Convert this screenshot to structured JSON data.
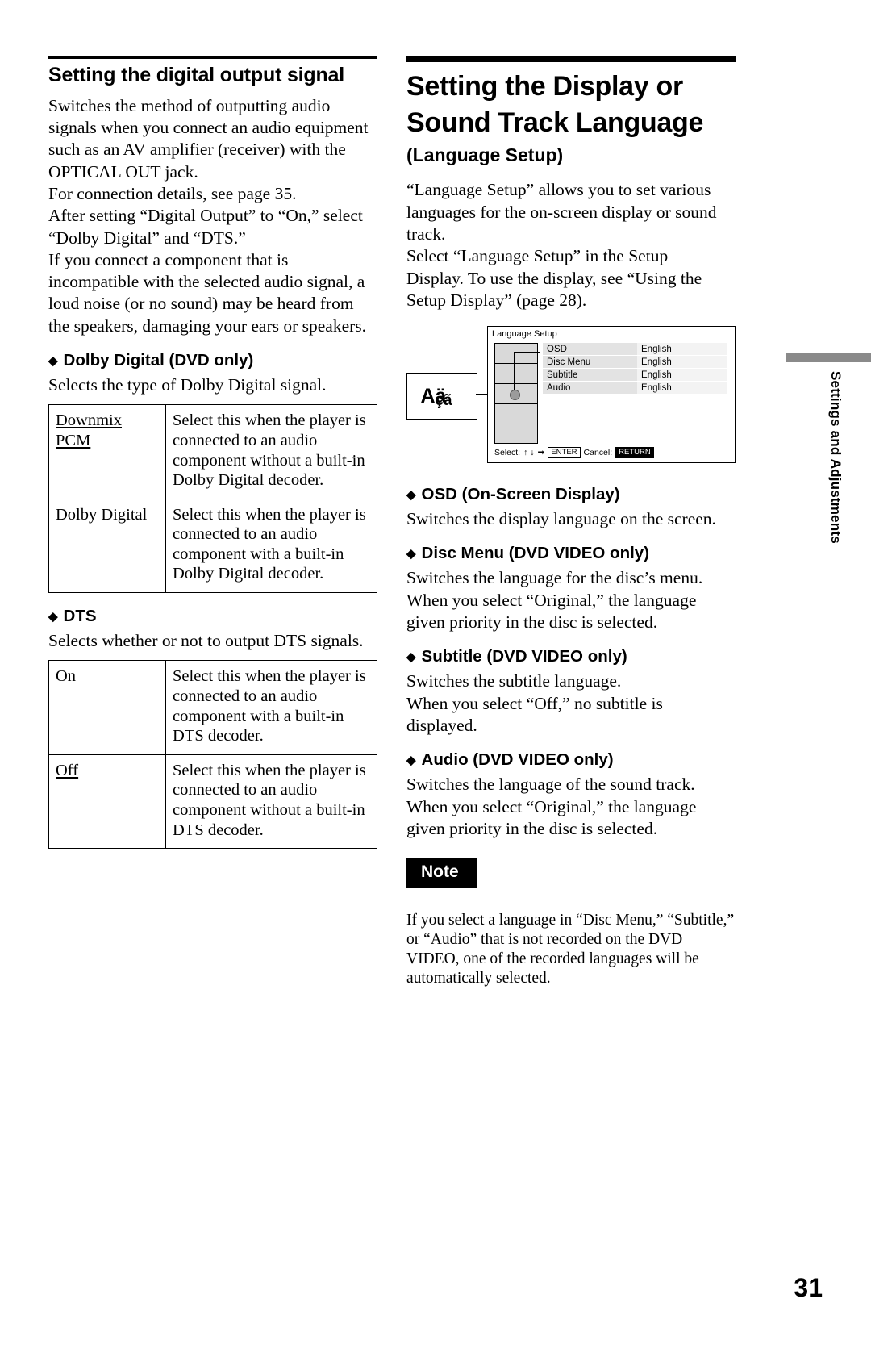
{
  "left": {
    "heading": "Setting the digital output signal",
    "intro_lines": [
      "Switches the method of outputting audio",
      "signals when you connect an audio equipment",
      "such as an AV amplifier (receiver) with the",
      "OPTICAL OUT jack.",
      "For connection details, see page 35.",
      "After setting “Digital Output” to “On,” select",
      "“Dolby Digital” and “DTS.”",
      "If you connect a component that is",
      "incompatible with the selected audio signal, a",
      "loud noise (or no sound) may be heard from",
      "the speakers, damaging your ears or speakers."
    ],
    "dolby": {
      "title": "Dolby Digital (DVD only)",
      "desc": "Selects the type of Dolby Digital signal.",
      "rows": [
        {
          "key_line1": "Downmix",
          "key_line2": "PCM",
          "value": "Select this when the player is connected to an audio component without a built-in Dolby Digital decoder."
        },
        {
          "key_line1": "Dolby Digital",
          "key_line2": "",
          "value": "Select this when the player is connected to an audio component with a built-in Dolby Digital decoder."
        }
      ]
    },
    "dts": {
      "title": "DTS",
      "desc": "Selects whether or not to output DTS signals.",
      "rows": [
        {
          "key_line1": "On",
          "key_line2": "",
          "value": "Select this when the player is connected to an audio component with a built-in DTS decoder."
        },
        {
          "key_line1": "Off",
          "key_line2": "",
          "value": "Select this when the player is connected to an audio component without a built-in DTS decoder."
        }
      ]
    }
  },
  "right": {
    "heading_line1": "Setting the Display or",
    "heading_line2": "Sound Track Language",
    "subheading": "(Language Setup)",
    "para1_lines": [
      "“Language Setup” allows you to set various",
      "languages for the on-screen display or sound",
      "track."
    ],
    "para2_lines": [
      "Select “Language Setup” in the Setup",
      "Display. To use the display, see “Using the",
      "Setup Display” (page 28)."
    ],
    "screen": {
      "title": "Language Setup",
      "icon_text": "Aä\nçã",
      "icon_line1": "Aä",
      "icon_line2": "çã",
      "rows": [
        {
          "label": "OSD",
          "value": "English"
        },
        {
          "label": "Disc Menu",
          "value": "English"
        },
        {
          "label": "Subtitle",
          "value": "English"
        },
        {
          "label": "Audio",
          "value": "English"
        }
      ],
      "footer_select": "Select:",
      "footer_arrows": "↑ ↓",
      "footer_arrow_right": "➡",
      "footer_enter": "ENTER",
      "footer_cancel": "Cancel:",
      "footer_return": "RETURN"
    },
    "items": [
      {
        "title": "OSD (On-Screen Display)",
        "lines": [
          "Switches the display language on the screen."
        ]
      },
      {
        "title": "Disc Menu (DVD VIDEO only)",
        "lines": [
          "Switches the language for the disc’s menu.",
          "When you select “Original,” the language",
          "given priority in the disc is selected."
        ]
      },
      {
        "title": "Subtitle (DVD VIDEO only)",
        "lines": [
          "Switches the subtitle language.",
          "When you select “Off,” no subtitle is",
          "displayed."
        ]
      },
      {
        "title": "Audio (DVD VIDEO only)",
        "lines": [
          "Switches the language of the sound track.",
          "When you select “Original,” the language",
          "given priority in the disc is selected."
        ]
      }
    ],
    "note": {
      "tag": "Note",
      "lines": [
        "If you select a language in “Disc Menu,” “Subtitle,”",
        "or “Audio” that is not recorded on the DVD",
        "VIDEO, one of the recorded languages will be",
        "automatically selected."
      ]
    }
  },
  "side_tab": "Settings and Adjustments",
  "page_number": "31"
}
